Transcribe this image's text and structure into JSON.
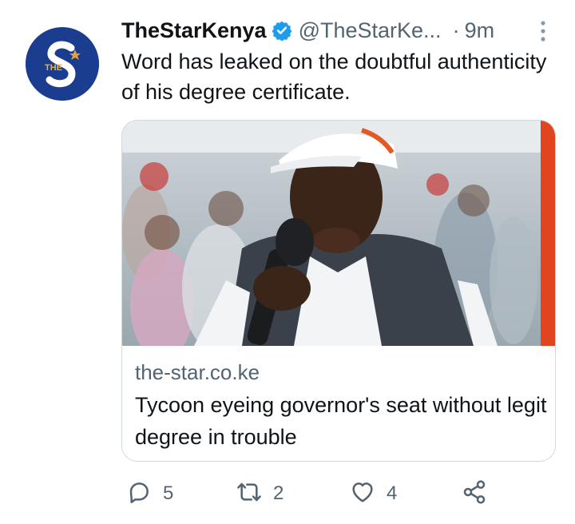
{
  "tweet": {
    "author": {
      "display_name": "TheStarKenya",
      "handle": "@TheStarKe...",
      "verified": true,
      "avatar_letters": "THE S",
      "avatar_color": "#1a3d8f"
    },
    "separator": "·",
    "time": "9m",
    "text": "Word has leaked on the doubtful authenticity of his degree certificate.",
    "card": {
      "domain": "the-star.co.ke",
      "title": "Tycoon eyeing governor's seat without legit degree in trouble",
      "image_alt": "Man in white cap speaking into a microphone"
    },
    "actions": {
      "reply_count": "5",
      "retweet_count": "2",
      "like_count": "4"
    }
  },
  "colors": {
    "accent": "#1d9bf0",
    "muted": "#536471",
    "border": "#cfd9de"
  },
  "icons": [
    "verified-badge-icon",
    "more-options-icon",
    "reply-icon",
    "retweet-icon",
    "like-icon",
    "share-icon"
  ]
}
